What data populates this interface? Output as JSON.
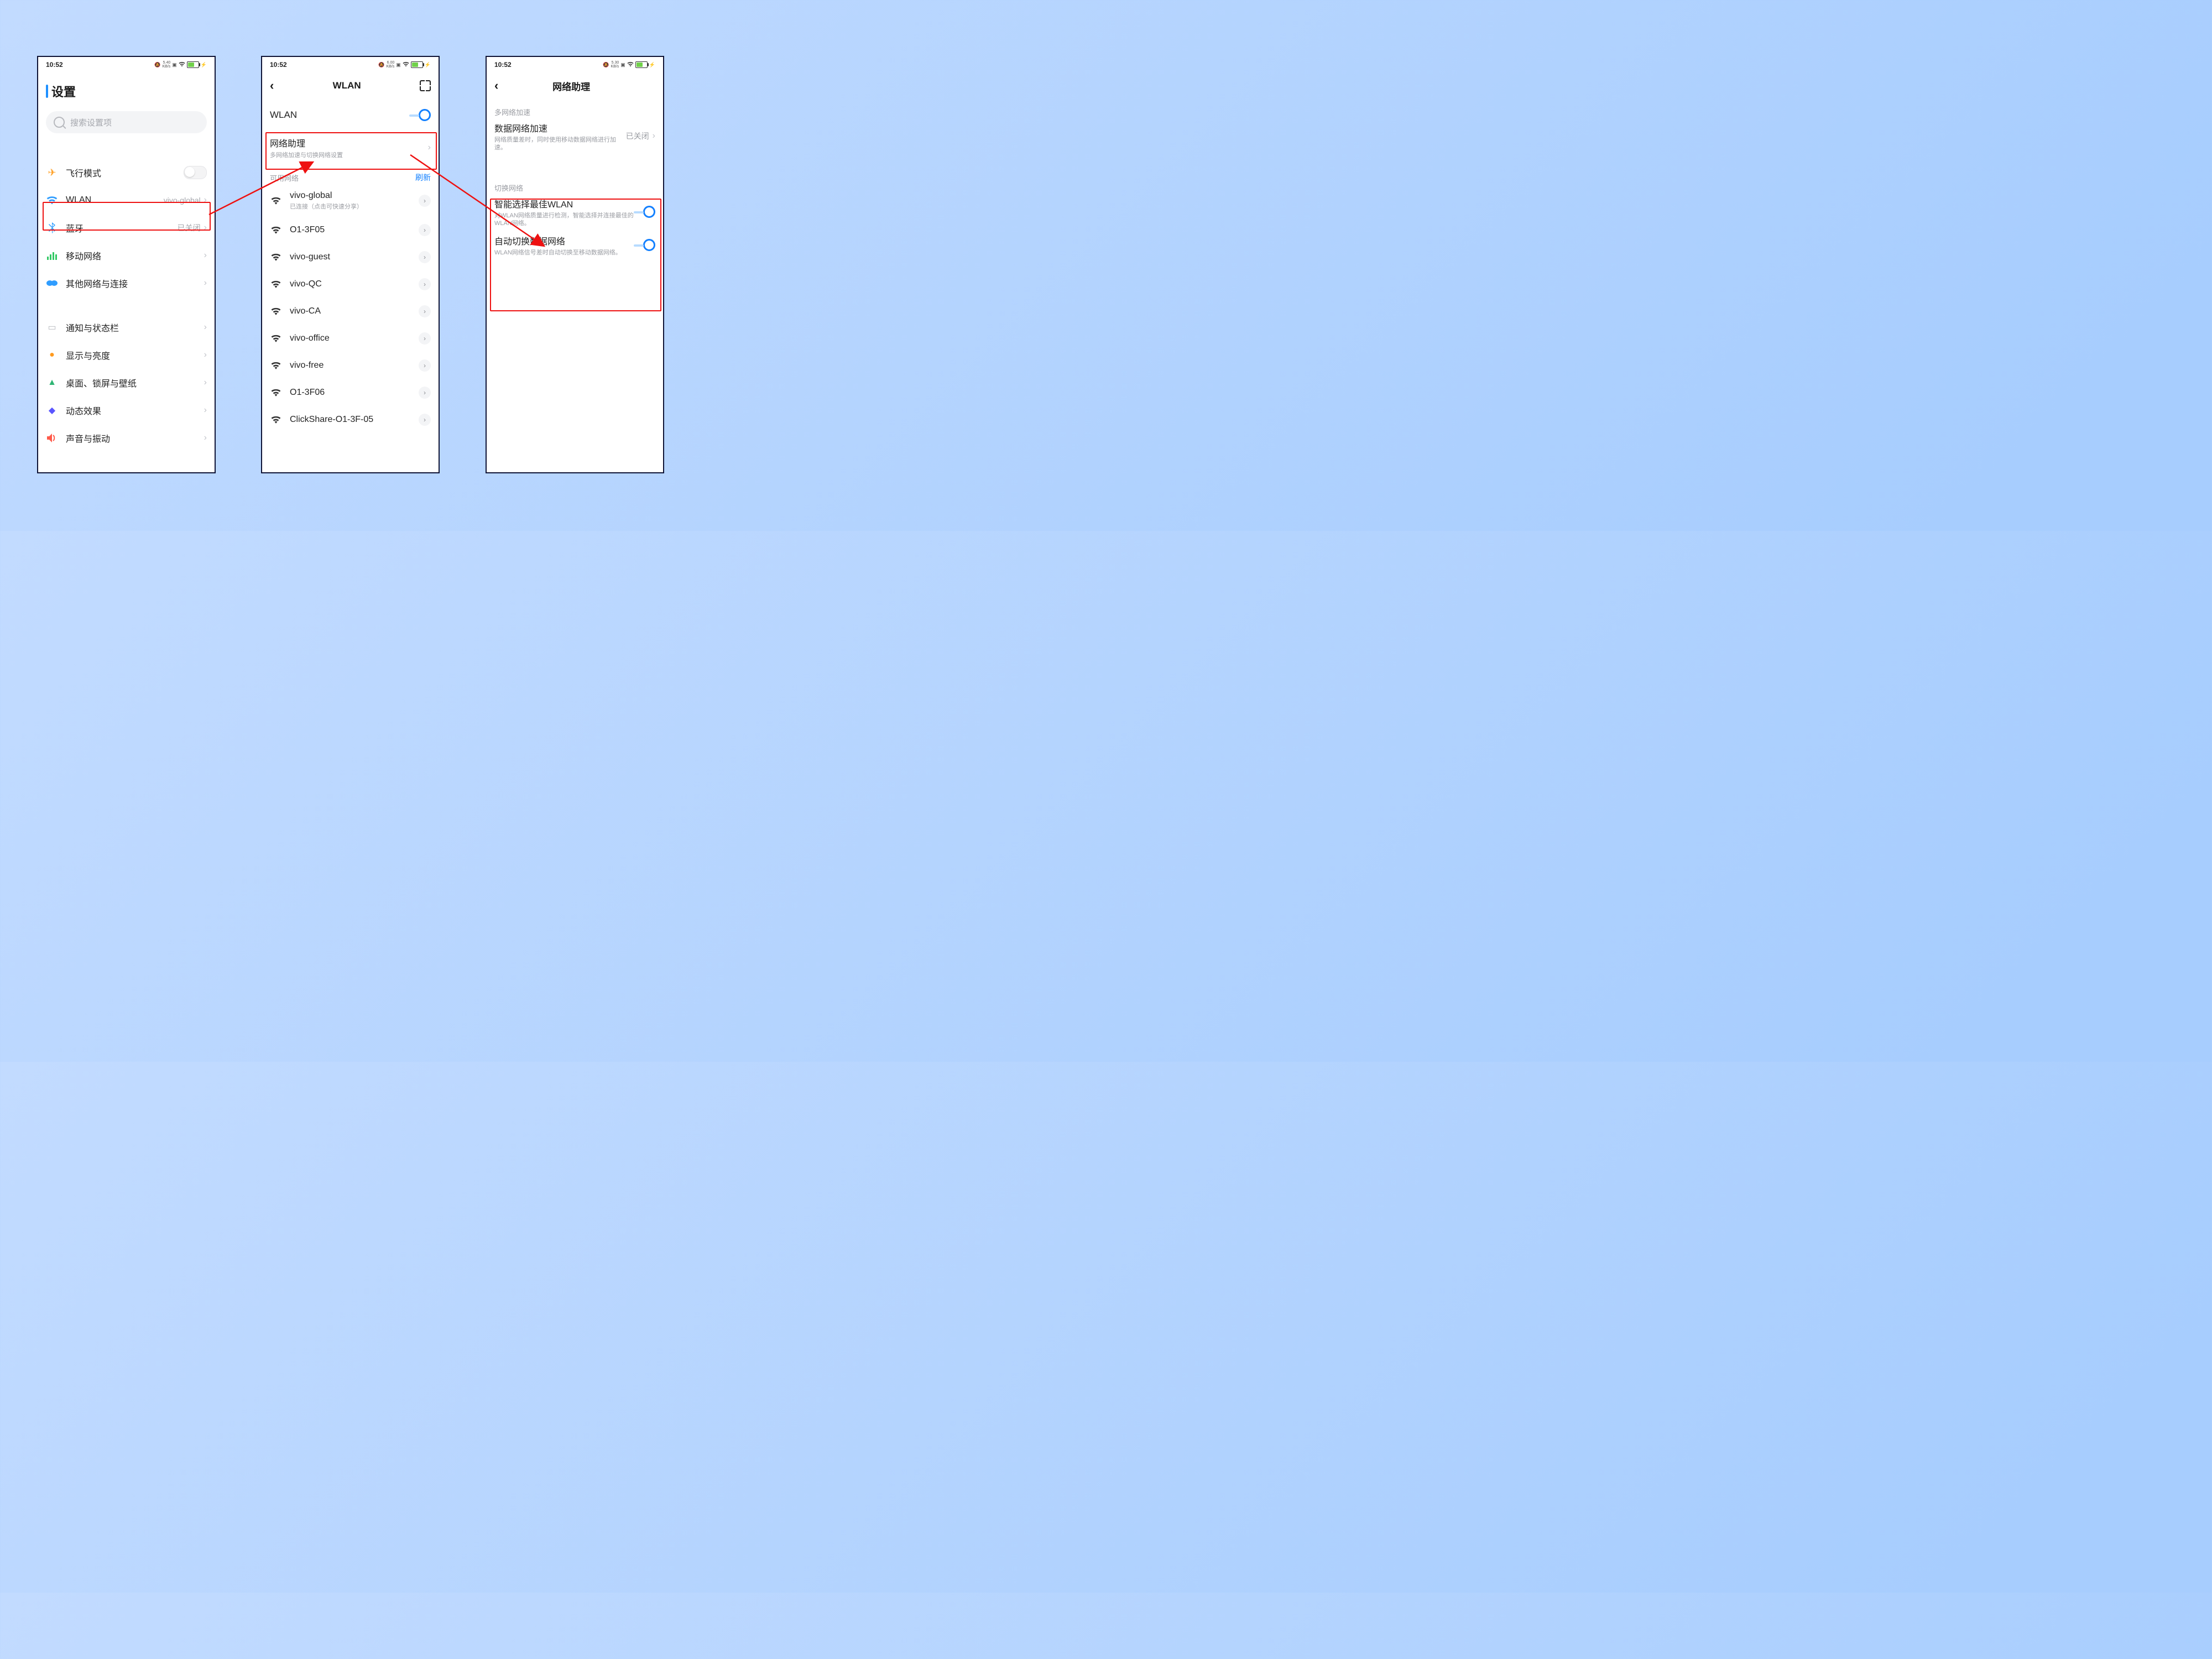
{
  "status": {
    "time": "10:52",
    "net1": "5.40",
    "net2": "6.00",
    "net3": "5.30",
    "unit": "KB/s"
  },
  "s1": {
    "title": "设置",
    "search_placeholder": "搜索设置项",
    "rows": {
      "airplane": "飞行模式",
      "wlan": "WLAN",
      "wlan_val": "vivo-global",
      "bt": "蓝牙",
      "bt_val": "已关闭",
      "mobile": "移动网络",
      "other": "其他网络与连接",
      "notif": "通知与状态栏",
      "display": "显示与亮度",
      "home": "桌面、锁屏与壁纸",
      "fx": "动态效果",
      "sound": "声音与振动"
    }
  },
  "s2": {
    "title": "WLAN",
    "wlan_label": "WLAN",
    "assist": "网络助理",
    "assist_sub": "多网络加速与切换网络设置",
    "available": "可用网络",
    "refresh": "刷新",
    "nets": [
      {
        "name": "vivo-global",
        "sub": "已连接（点击可快速分享）"
      },
      {
        "name": "O1-3F05"
      },
      {
        "name": "vivo-guest"
      },
      {
        "name": "vivo-QC"
      },
      {
        "name": "vivo-CA"
      },
      {
        "name": "vivo-office"
      },
      {
        "name": "vivo-free"
      },
      {
        "name": "O1-3F06"
      },
      {
        "name": "ClickShare-O1-3F-05"
      }
    ]
  },
  "s3": {
    "title": "网络助理",
    "sec1": "多网络加速",
    "accel": "数据网络加速",
    "accel_sub": "网络质量差时，同时使用移动数据网络进行加速。",
    "accel_state": "已关闭",
    "sec2": "切换网络",
    "smart": "智能选择最佳WLAN",
    "smart_sub": "对WLAN网络质量进行检测，智能选择并连接最佳的WLAN网络。",
    "auto": "自动切换数据网络",
    "auto_sub": "WLAN网络信号差时自动切换至移动数据网络。"
  }
}
